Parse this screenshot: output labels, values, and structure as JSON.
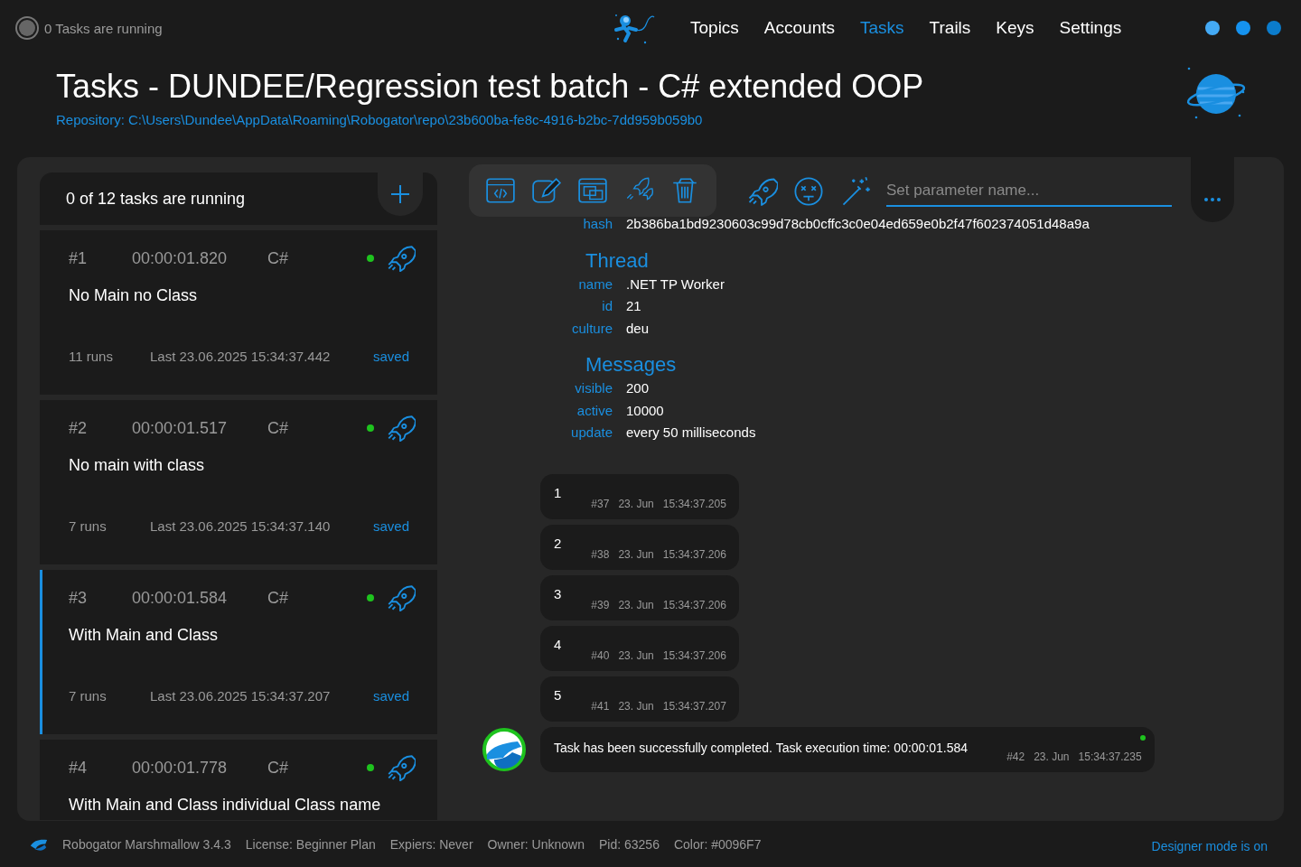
{
  "top_bar": {
    "running_status": "0 Tasks are running",
    "nav": [
      {
        "label": "Topics",
        "selected": false
      },
      {
        "label": "Accounts",
        "selected": false
      },
      {
        "label": "Tasks",
        "selected": true
      },
      {
        "label": "Trails",
        "selected": false
      },
      {
        "label": "Keys",
        "selected": false
      },
      {
        "label": "Settings",
        "selected": false
      }
    ]
  },
  "header": {
    "title": "Tasks - DUNDEE/Regression test batch - C# extended OOP",
    "repository": "Repository: C:\\Users\\Dundee\\AppData\\Roaming\\Robogator\\repo\\23b600ba-fe8c-4916-b2bc-7dd959b059b0"
  },
  "task_list": {
    "summary": "0 of 12 tasks are running",
    "tasks": [
      {
        "number": "#1",
        "duration": "00:00:01.820",
        "language": "C#",
        "color": "#1ec31e",
        "name": "No Main no Class",
        "runs": "11 runs",
        "last": "Last 23.06.2025 15:34:37.442",
        "state": "saved",
        "selected": false
      },
      {
        "number": "#2",
        "duration": "00:00:01.517",
        "language": "C#",
        "color": "#1ec31e",
        "name": "No main with class",
        "runs": "7 runs",
        "last": "Last 23.06.2025 15:34:37.140",
        "state": "saved",
        "selected": false
      },
      {
        "number": "#3",
        "duration": "00:00:01.584",
        "language": "C#",
        "color": "#1ec31e",
        "name": "With Main and Class",
        "runs": "7 runs",
        "last": "Last 23.06.2025 15:34:37.207",
        "state": "saved",
        "selected": true
      },
      {
        "number": "#4",
        "duration": "00:00:01.778",
        "language": "C#",
        "color": "#1ec31e",
        "name": "With Main and Class individual Class name",
        "selected": false
      }
    ]
  },
  "toolbar": {
    "parameter_field": {
      "placeholder": "Set parameter name..."
    }
  },
  "details": {
    "hash": {
      "label": "hash",
      "value": "2b386ba1bd9230603c99d78cb0cffc3c0e04ed659e0b2f47f602374051d48a9a"
    },
    "sections": [
      {
        "title": "Thread",
        "rows": [
          {
            "label": "name",
            "value": ".NET TP Worker"
          },
          {
            "label": "id",
            "value": "21"
          },
          {
            "label": "culture",
            "value": "deu"
          }
        ]
      },
      {
        "title": "Messages",
        "rows": [
          {
            "label": "visible",
            "value": "200"
          },
          {
            "label": "active",
            "value": "10000"
          },
          {
            "label": "update",
            "value": "every 50 milliseconds"
          }
        ]
      }
    ]
  },
  "messages": [
    {
      "kind": "output",
      "text": "1",
      "number": "#37",
      "date": "23. Jun",
      "time": "15:34:37.205"
    },
    {
      "kind": "output",
      "text": "2",
      "number": "#38",
      "date": "23. Jun",
      "time": "15:34:37.206"
    },
    {
      "kind": "output",
      "text": "3",
      "number": "#39",
      "date": "23. Jun",
      "time": "15:34:37.206"
    },
    {
      "kind": "output",
      "text": "4",
      "number": "#40",
      "date": "23. Jun",
      "time": "15:34:37.206"
    },
    {
      "kind": "output",
      "text": "5",
      "number": "#41",
      "date": "23. Jun",
      "time": "15:34:37.207"
    },
    {
      "kind": "result",
      "text": "Task has been successfully completed. Task execution time: 00:00:01.584",
      "number": "#42",
      "date": "23. Jun",
      "time": "15:34:37.235"
    }
  ],
  "status_bar": {
    "items": [
      "Robogator Marshmallow 3.4.3",
      "License: Beginner Plan",
      "Expiers: Never",
      "Owner: Unknown",
      "Pid: 63256",
      "Color: #0096F7"
    ],
    "designer_mode": "Designer mode is on"
  }
}
